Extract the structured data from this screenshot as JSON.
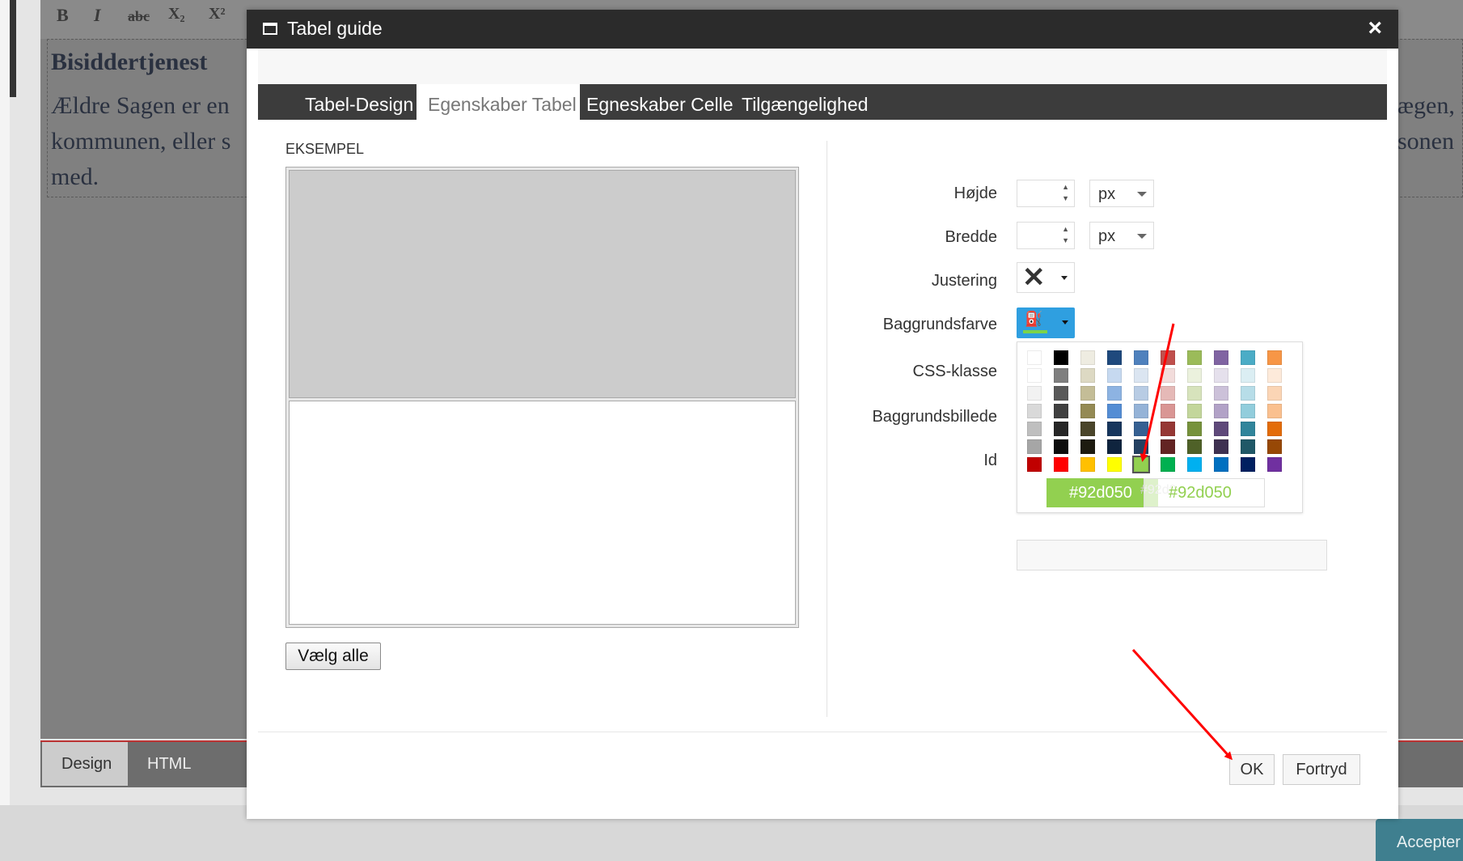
{
  "editor": {
    "toolbar_buttons": [
      "B",
      "I",
      "abc",
      "X₂",
      "X²"
    ],
    "heading": "Bisiddertjenest",
    "lines": [
      "Ældre Sagen er en",
      "kommunen, eller s",
      "med."
    ],
    "right_lines": [
      "ægen, i",
      "sonen"
    ],
    "bottom_tabs": {
      "design": "Design",
      "html": "HTML"
    },
    "accept_label": "Accepter"
  },
  "dialog": {
    "title": "Tabel guide",
    "close": "×",
    "tabs": [
      "Tabel-Design",
      "Egenskaber Tabel",
      "Egneskaber Celle",
      "Tilgængelighed"
    ],
    "active_tab": "Egenskaber Tabel",
    "example_label": "EKSEMPEL",
    "select_all": "Vælg alle",
    "fields": {
      "height_label": "Højde",
      "height_unit": "px",
      "width_label": "Bredde",
      "width_unit": "px",
      "justify_label": "Justering",
      "bg_color_label": "Baggrundsfarve",
      "css_label": "CSS-klasse",
      "bg_image_label": "Baggrundsbillede",
      "id_label": "Id"
    },
    "palette": {
      "columns": [
        [
          "#ffffff",
          "#f2f2f2",
          "#d9d9d9",
          "#bfbfbf",
          "#a6a6a6",
          "#c00000"
        ],
        [
          "#000000",
          "#7f7f7f",
          "#595959",
          "#404040",
          "#262626",
          "#0d0d0d",
          "#ff0000"
        ],
        [
          "#eeece1",
          "#ddd9c3",
          "#c4bd97",
          "#948a54",
          "#4a452a",
          "#1d1b10",
          "#ffc000"
        ],
        [
          "#1f497d",
          "#c6d9f0",
          "#8db3e2",
          "#548dd4",
          "#17365d",
          "#0f243e",
          "#ffff00"
        ],
        [
          "#4f81bd",
          "#dbe5f1",
          "#b8cce4",
          "#95b3d7",
          "#366092",
          "#244061",
          "#92d050"
        ],
        [
          "#c0504d",
          "#f2dcdb",
          "#e5b9b7",
          "#d99694",
          "#953734",
          "#632423",
          "#00b050"
        ],
        [
          "#9bbb59",
          "#ebf1dd",
          "#d7e3bc",
          "#c3d69b",
          "#76923c",
          "#4f6128",
          "#00b0f0"
        ],
        [
          "#8064a2",
          "#e5e0ec",
          "#ccc1d9",
          "#b2a2c7",
          "#5f497a",
          "#3f3151",
          "#0070c0"
        ],
        [
          "#4bacc6",
          "#dbeef3",
          "#b7dde8",
          "#92cddc",
          "#31859b",
          "#205867",
          "#002060"
        ],
        [
          "#f79646",
          "#fdeada",
          "#fbd5b5",
          "#fac08f",
          "#e36c09",
          "#974806",
          "#7030a0"
        ]
      ],
      "selected": "#92d050",
      "hex_preview": "#92d050",
      "hex_ghost": "#92d0",
      "hex_input": "#92d050"
    },
    "ok": "OK",
    "cancel": "Fortryd"
  },
  "colors": {
    "titlebar": "#2b2b2b",
    "tabbar": "#3c3c3c",
    "accent_blue": "#2f9fe0",
    "annotation": "#ff0000"
  }
}
